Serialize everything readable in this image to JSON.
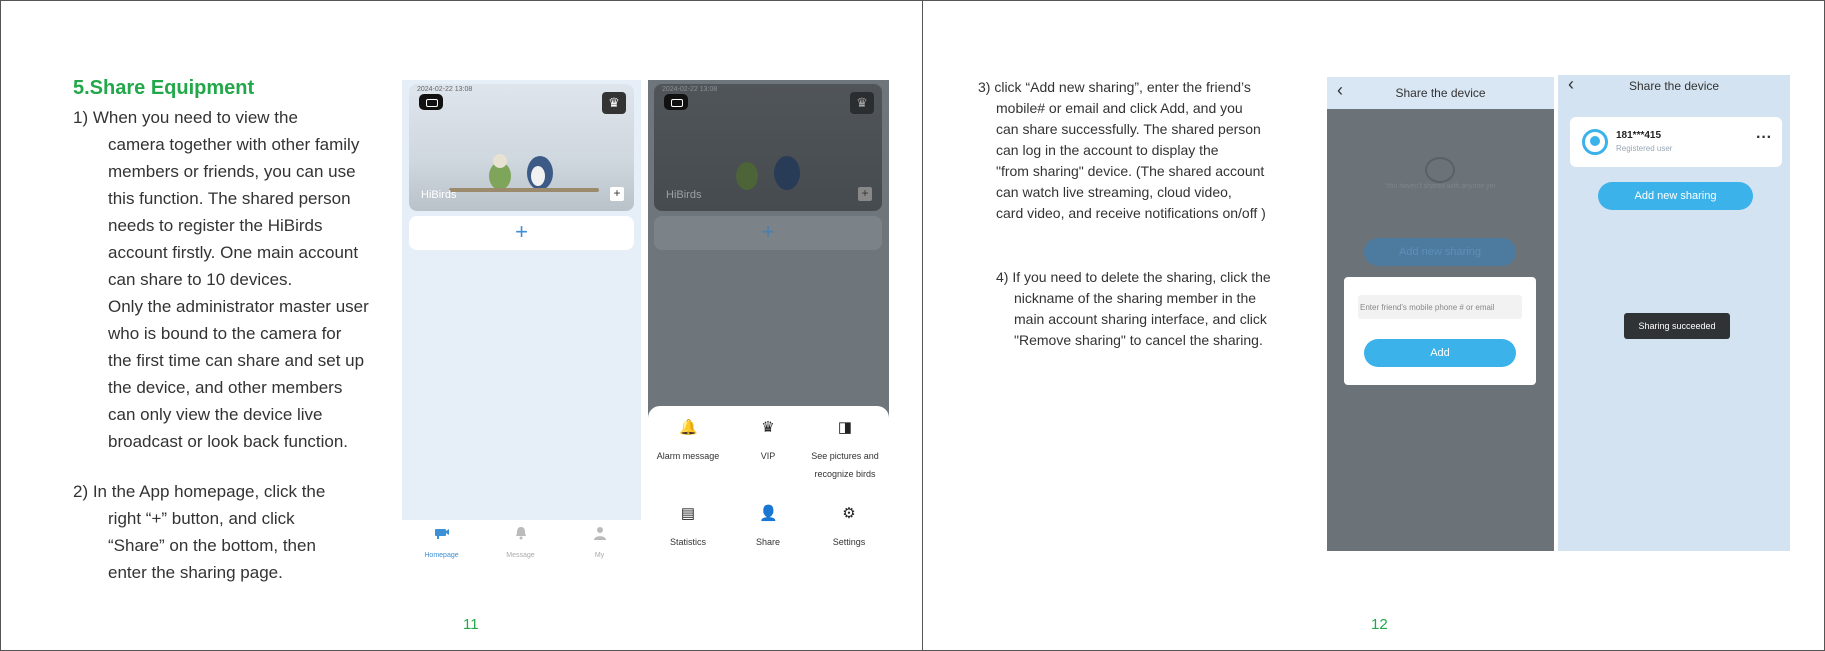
{
  "left_page": {
    "section_title": "5.Share Equipment",
    "step1": [
      "1) When you need to view the",
      "camera together with other family",
      "members or friends, you can use",
      "this function. The shared person",
      "needs to register the HiBirds",
      "account firstly. One main account",
      "can share to 10 devices.",
      "Only the administrator master user",
      "who is bound to the camera for",
      "the first time can share and set up",
      "the device,  and other members",
      "can only view the device live",
      "broadcast or look back function."
    ],
    "step2": [
      "2) In the App homepage, click the",
      "right “+” button, and click",
      "“Share” on the bottom, then",
      "enter the sharing page."
    ],
    "page_number": "11"
  },
  "right_page": {
    "step3": [
      "3) click “Add new sharing”, enter the friend’s",
      "mobile# or email and click Add, and you",
      "can share successfully. The shared person",
      "can log in the account to display the",
      "\"from sharing\" device. (The shared account",
      "can watch live streaming, cloud video,",
      "card video, and receive notifications on/off )"
    ],
    "step4": [
      "4) If you need to delete the sharing, click the",
      "nickname of  the sharing member in the",
      "main account sharing interface, and click",
      "\"Remove sharing\" to cancel the sharing."
    ],
    "page_number": "12"
  },
  "homepage_screen": {
    "camera_name": "HiBirds",
    "timestamp": "2024-02-22 13:08",
    "add_symbol": "+",
    "tabs": [
      {
        "label": "Homepage",
        "icon": "camera-icon",
        "active": true
      },
      {
        "label": "Message",
        "icon": "bell-icon",
        "active": false
      },
      {
        "label": "My",
        "icon": "person-icon",
        "active": false
      }
    ]
  },
  "share_menu_screen": {
    "camera_name": "HiBirds",
    "timestamp": "2024-02-22 13:08",
    "add_symbol": "+",
    "menu_items": [
      {
        "label": "Alarm message",
        "icon": "bell-icon"
      },
      {
        "label": "VIP",
        "icon": "crown-icon"
      },
      {
        "label": "See pictures and recognize birds",
        "icon": "bird-icon"
      },
      {
        "label": "Statistics",
        "icon": "document-icon"
      },
      {
        "label": "Share",
        "icon": "add-person-icon"
      },
      {
        "label": "Settings",
        "icon": "gear-icon"
      }
    ]
  },
  "share_dialog_screen": {
    "title": "Share the device",
    "empty_text": "You haven't shared with anyone yet",
    "add_new_label": "Add new sharing",
    "input_placeholder": "Enter friend's mobile phone # or email",
    "add_button": "Add"
  },
  "share_result_screen": {
    "title": "Share the device",
    "user_phone": "181***415",
    "user_role": "Registered user",
    "more_label": "···",
    "add_new_label": "Add new sharing",
    "toast": "Sharing succeeded"
  },
  "colors": {
    "accent_green": "#22a84a",
    "app_blue": "#3bb2ea",
    "tab_active": "#3d8fd6"
  }
}
